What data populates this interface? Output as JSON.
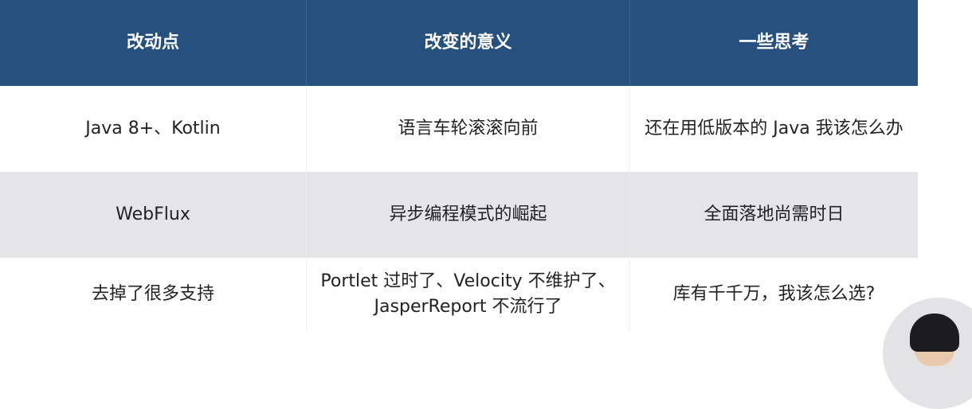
{
  "table": {
    "headers": [
      "改动点",
      "改变的意义",
      "一些思考"
    ],
    "rows": [
      [
        "Java 8+、Kotlin",
        "语言车轮滚滚向前",
        "还在用低版本的 Java 我该怎么办"
      ],
      [
        "WebFlux",
        "异步编程模式的崛起",
        "全面落地尚需时日"
      ],
      [
        "去掉了很多支持",
        [
          "Portlet 过时了、Velocity 不维护了、",
          "JasperReport 不流行了"
        ],
        "库有千千万，我该怎么选?"
      ]
    ]
  }
}
